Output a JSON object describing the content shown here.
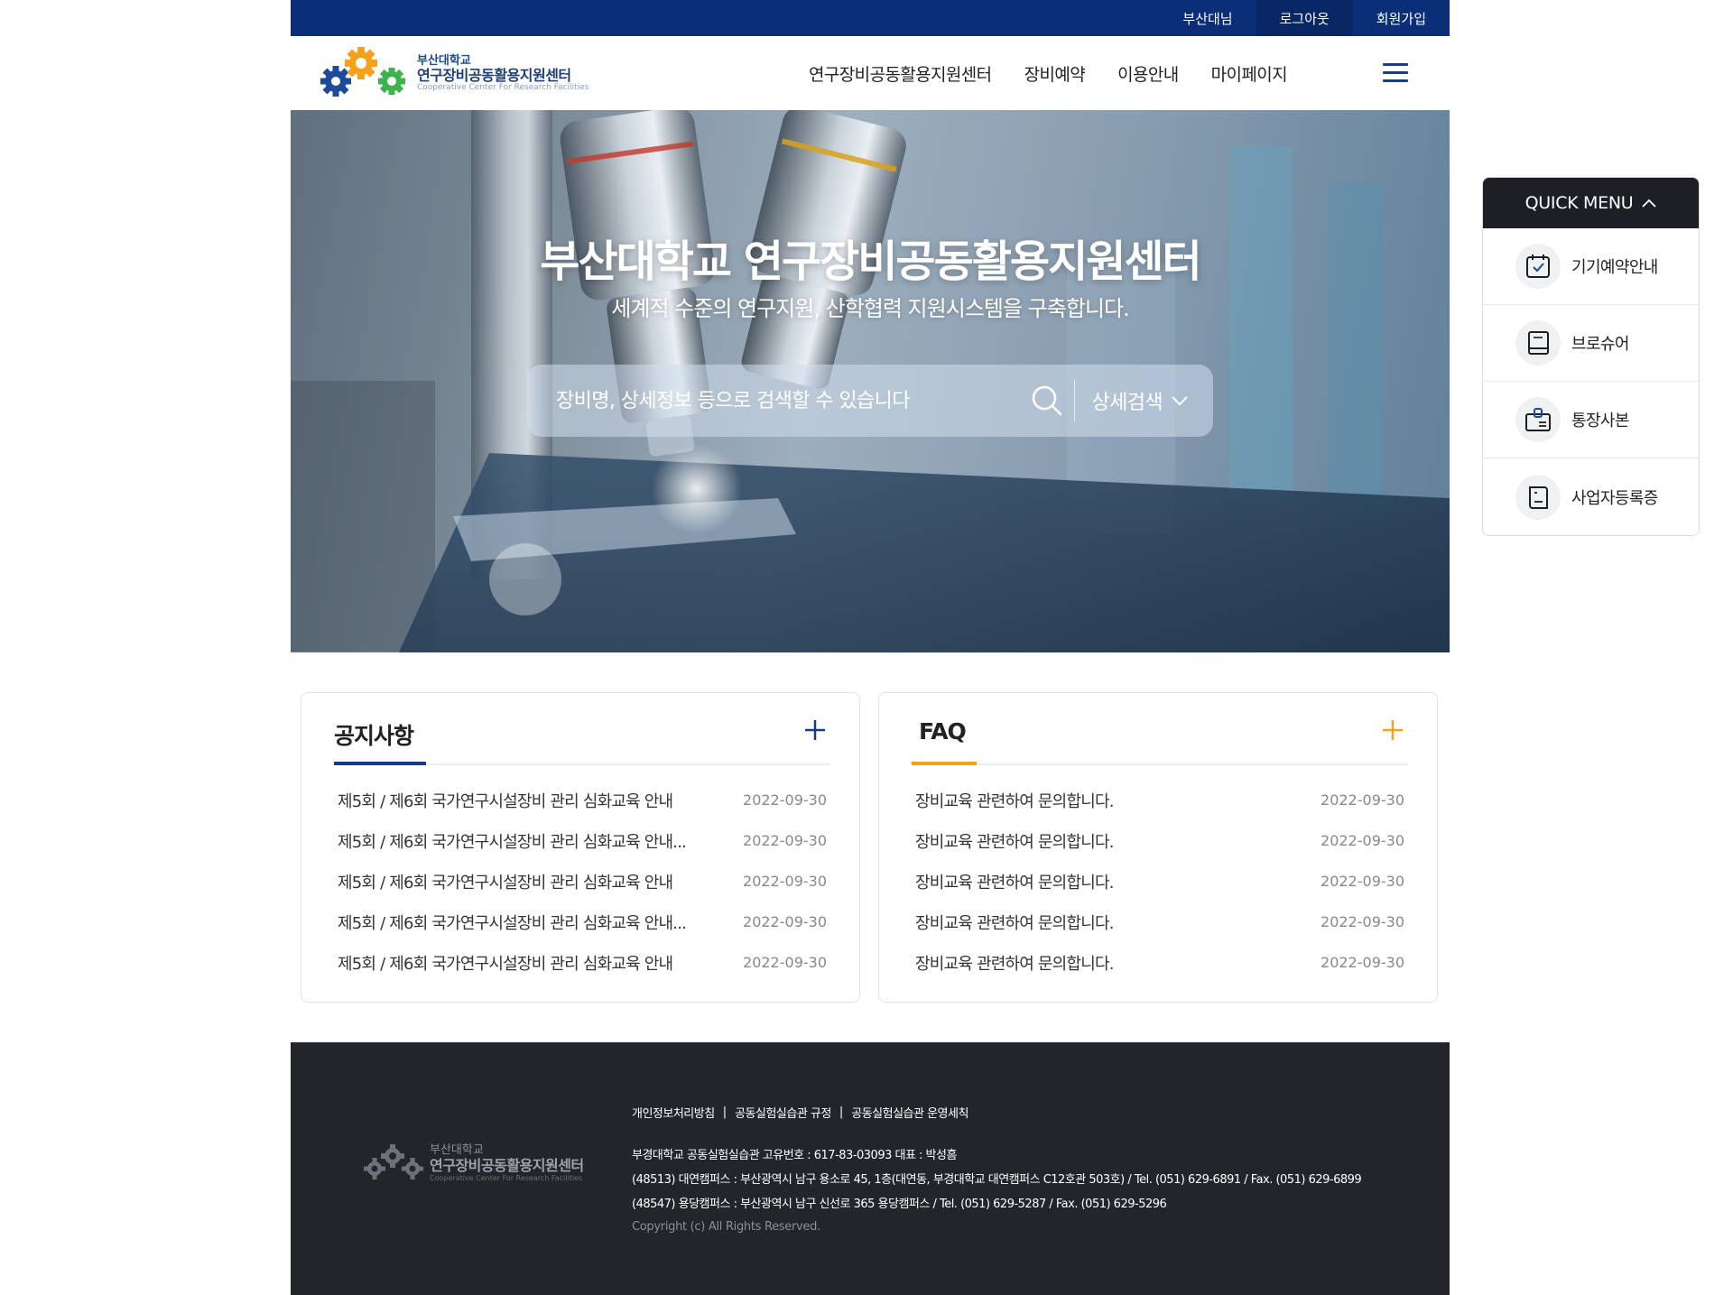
{
  "utility": {
    "links": [
      "부산대님",
      "로그아웃",
      "회원가입"
    ]
  },
  "header": {
    "logo": {
      "sub": "부산대학교",
      "main": "연구장비공동활용지원센터",
      "eng": "Cooperative Center For Research Facilities"
    },
    "nav": [
      "연구장비공동활용지원센터",
      "장비예약",
      "이용안내",
      "마이페이지"
    ]
  },
  "hero": {
    "title": "부산대학교 연구장비공동활용지원센터",
    "subtitle": "세계적 수준의 연구지원, 산학협력 지원시스템을 구축합니다.",
    "search_placeholder": "장비명, 상세정보 등으로 검색할 수 있습니다",
    "detail_search": "상세검색"
  },
  "notice": {
    "title": "공지사항",
    "accent": "#143d84",
    "items": [
      {
        "title": "제5회 / 제6회 국가연구시설장비 관리 심화교육 안내",
        "date": "2022-09-30"
      },
      {
        "title": "제5회 / 제6회 국가연구시설장비 관리 심화교육 안내...",
        "date": "2022-09-30"
      },
      {
        "title": "제5회 / 제6회 국가연구시설장비 관리 심화교육 안내",
        "date": "2022-09-30"
      },
      {
        "title": "제5회 / 제6회 국가연구시설장비 관리 심화교육 안내...",
        "date": "2022-09-30"
      },
      {
        "title": "제5회 / 제6회 국가연구시설장비 관리 심화교육 안내",
        "date": "2022-09-30"
      }
    ]
  },
  "faq": {
    "title": "FAQ",
    "accent": "#f0a21e",
    "items": [
      {
        "title": "장비교육 관련하여 문의합니다.",
        "date": "2022-09-30"
      },
      {
        "title": "장비교육 관련하여 문의합니다.",
        "date": "2022-09-30"
      },
      {
        "title": "장비교육 관련하여 문의합니다.",
        "date": "2022-09-30"
      },
      {
        "title": "장비교육 관련하여 문의합니다.",
        "date": "2022-09-30"
      },
      {
        "title": "장비교육 관련하여 문의합니다.",
        "date": "2022-09-30"
      }
    ]
  },
  "footer": {
    "logo": {
      "sub": "부산대학교",
      "main": "연구장비공동활용지원센터",
      "eng": "Cooperative Center For Research Facilities"
    },
    "links": [
      "개인정보처리방침",
      "공동실험실습관 규정",
      "공동실험실습관 운영세칙"
    ],
    "info": [
      "부경대학교 공동실험실습관 고유번호 : 617-83-03093 대표 : 박성흠",
      "(48513) 대연캠퍼스 : 부산광역시 남구 용소로 45, 1층(대연동, 부경대학교 대연캠퍼스 C12호관 503호) / Tel. (051) 629-6891 / Fax. (051) 629-6899",
      "(48547) 용당캠퍼스 : 부산광역시 남구 신선로 365 용당캠퍼스 / Tel. (051) 629-5287 / Fax. (051) 629-5296"
    ],
    "copyright": "Copyright (c) All Rights Reserved."
  },
  "quick_menu": {
    "title": "QUICK MENU",
    "items": [
      {
        "label": "기기예약안내",
        "icon": "calendar-check-icon"
      },
      {
        "label": "브로슈어",
        "icon": "book-icon"
      },
      {
        "label": "통장사본",
        "icon": "bankbook-icon"
      },
      {
        "label": "사업자등록증",
        "icon": "certificate-icon"
      }
    ]
  },
  "colors": {
    "primary_navy": "#0a2f78",
    "accent_orange": "#f0a21e",
    "footer_bg": "#23252a"
  }
}
